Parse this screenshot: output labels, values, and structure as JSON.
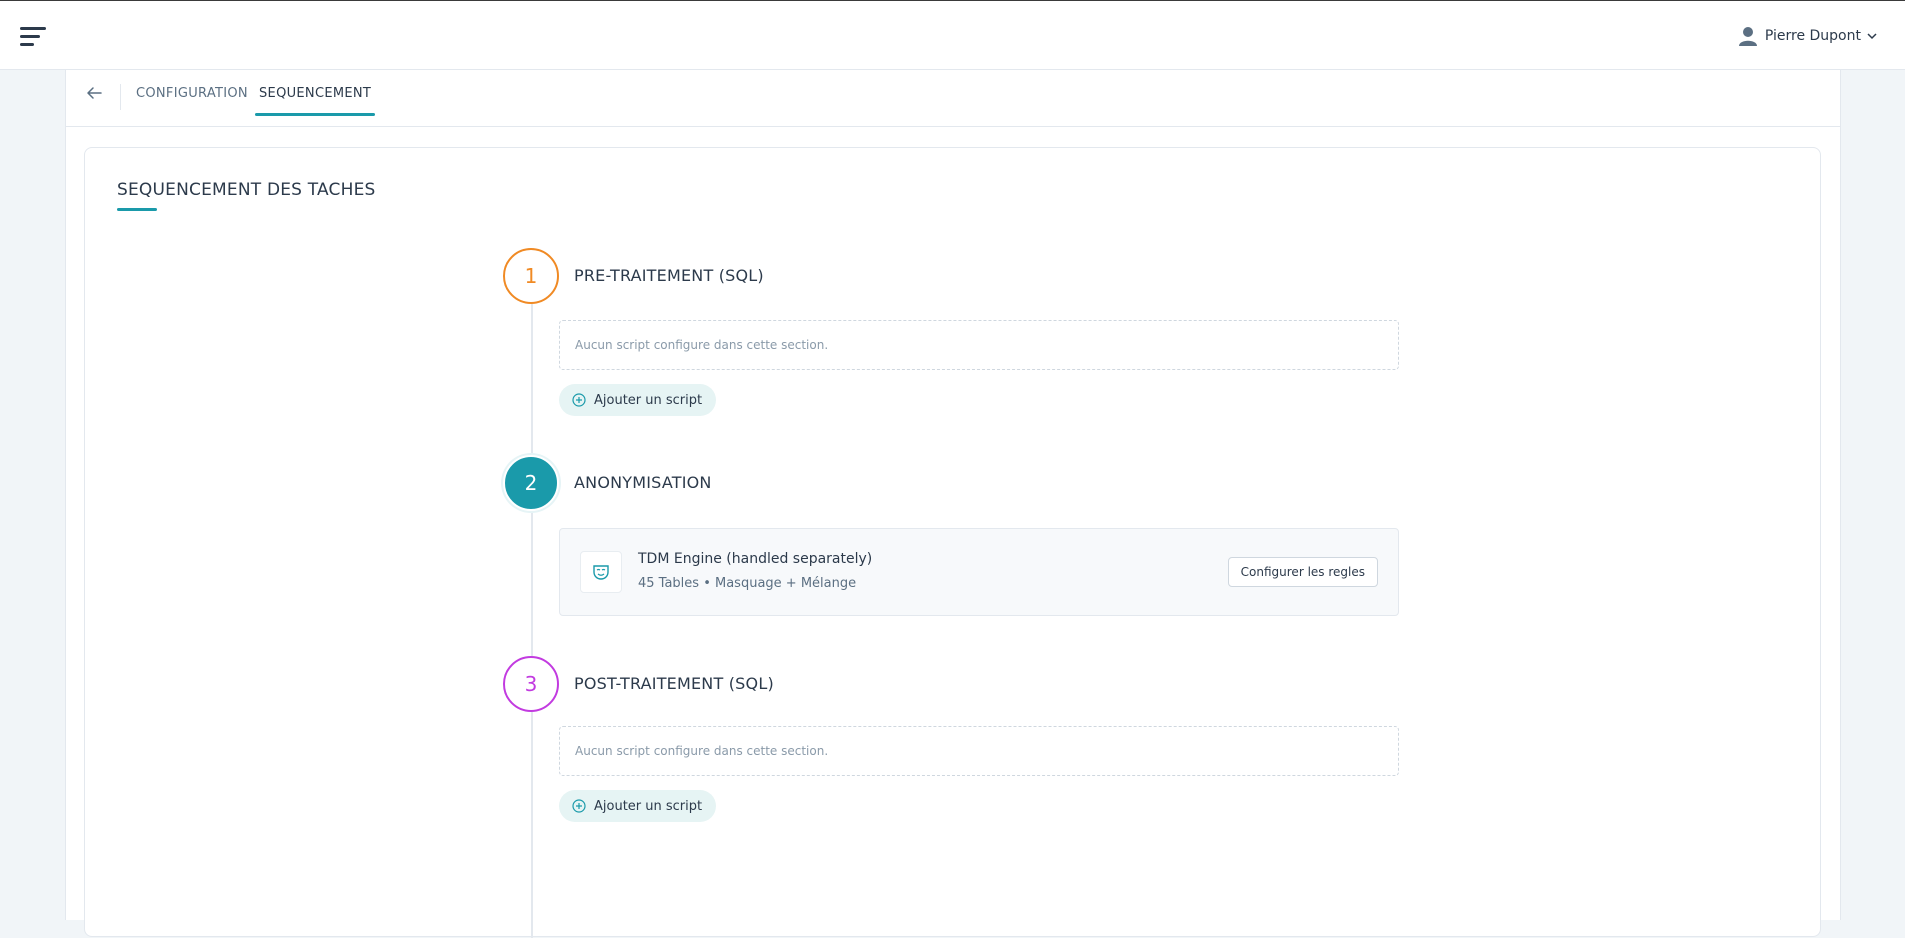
{
  "header": {
    "user_name": "Pierre Dupont"
  },
  "tabs": {
    "configuration": "CONFIGURATION",
    "sequencement": "SEQUENCEMENT"
  },
  "page": {
    "section_title": "SEQUENCEMENT DES TACHES"
  },
  "steps": [
    {
      "number": "1",
      "title": "PRE-TRAITEMENT (SQL)",
      "empty_text": "Aucun script configure dans cette section.",
      "add_label": "Ajouter un script",
      "color": "#f08a24"
    },
    {
      "number": "2",
      "title": "ANONYMISATION",
      "engine_name": "TDM Engine (handled separately)",
      "engine_meta": "45 Tables • Masquage + Mélange",
      "config_label": "Configurer les regles",
      "color": "#1a9aaa"
    },
    {
      "number": "3",
      "title": "POST-TRAITEMENT (SQL)",
      "empty_text": "Aucun script configure dans cette section.",
      "add_label": "Ajouter un script",
      "color": "#c23be0"
    }
  ],
  "colors": {
    "accent": "#1a9aaa",
    "background": "#f1f5f8"
  },
  "icons": {
    "menu": "hamburger-menu-icon",
    "user": "user-icon",
    "dropdown": "chevron-down-icon",
    "back": "arrow-left-icon",
    "add": "plus-circle-icon",
    "engine": "mask-icon"
  }
}
